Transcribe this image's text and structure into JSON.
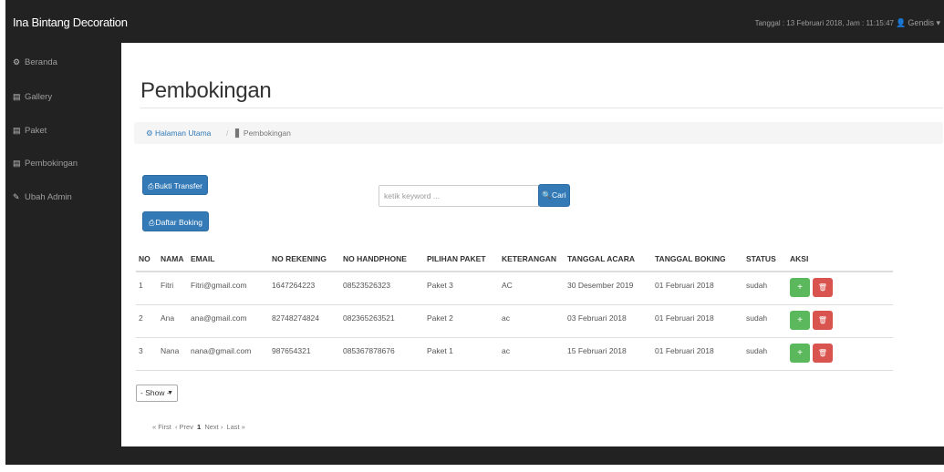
{
  "app": {
    "brand": "Ina Bintang Decoration",
    "date_info": "Tanggal : 13 Februari 2018, Jam : 11:15:47",
    "user": "Gendis"
  },
  "sidebar": {
    "items": [
      {
        "label": "Beranda",
        "icon": "dashboard-icon"
      },
      {
        "label": "Gallery",
        "icon": "file-icon"
      },
      {
        "label": "Paket",
        "icon": "file-icon"
      },
      {
        "label": "Pembokingan",
        "icon": "file-icon"
      },
      {
        "label": "Ubah Admin",
        "icon": "edit-icon"
      }
    ]
  },
  "page": {
    "title": "Pembokingan",
    "breadcrumb": {
      "home": "Halaman Utama",
      "separator": "/",
      "current": "Pembokingan"
    }
  },
  "toolbar": {
    "bukti_transfer": "Bukti Transfer",
    "daftar_boking": "Daftar Boking",
    "search_placeholder": "ketik keyword ...",
    "search_button": "Cari"
  },
  "table": {
    "headers": [
      "NO",
      "NAMA",
      "EMAIL",
      "NO REKENING",
      "NO HANDPHONE",
      "PILIHAN PAKET",
      "KETERANGAN",
      "TANGGAL ACARA",
      "TANGGAL BOKING",
      "STATUS",
      "AKSI"
    ],
    "rows": [
      [
        "1",
        "Fitri",
        "Fitri@gmail.com",
        "1647264223",
        "08523526323",
        "Paket 3",
        "AC",
        "30 Desember 2019",
        "01 Februari 2018",
        "sudah"
      ],
      [
        "2",
        "Ana",
        "ana@gmail.com",
        "82748274824",
        "082365263521",
        "Paket 2",
        "ac",
        "03 Februari 2018",
        "01 Februari 2018",
        "sudah"
      ],
      [
        "3",
        "Nana",
        "nana@gmail.com",
        "987654321",
        "085367878676",
        "Paket 1",
        "ac",
        "15 Februari 2018",
        "01 Februari 2018",
        "sudah"
      ]
    ],
    "action_add": "+",
    "action_delete": "🗑"
  },
  "show_select": {
    "value": "- Show -"
  },
  "pagination": {
    "first": "« First",
    "prev": "‹ Prev",
    "current": "1",
    "next": "Next ›",
    "last": "Last »"
  },
  "colors": {
    "primary": "#337ab7",
    "success": "#5cb85c",
    "danger": "#d9534f",
    "navbar": "#222222"
  }
}
